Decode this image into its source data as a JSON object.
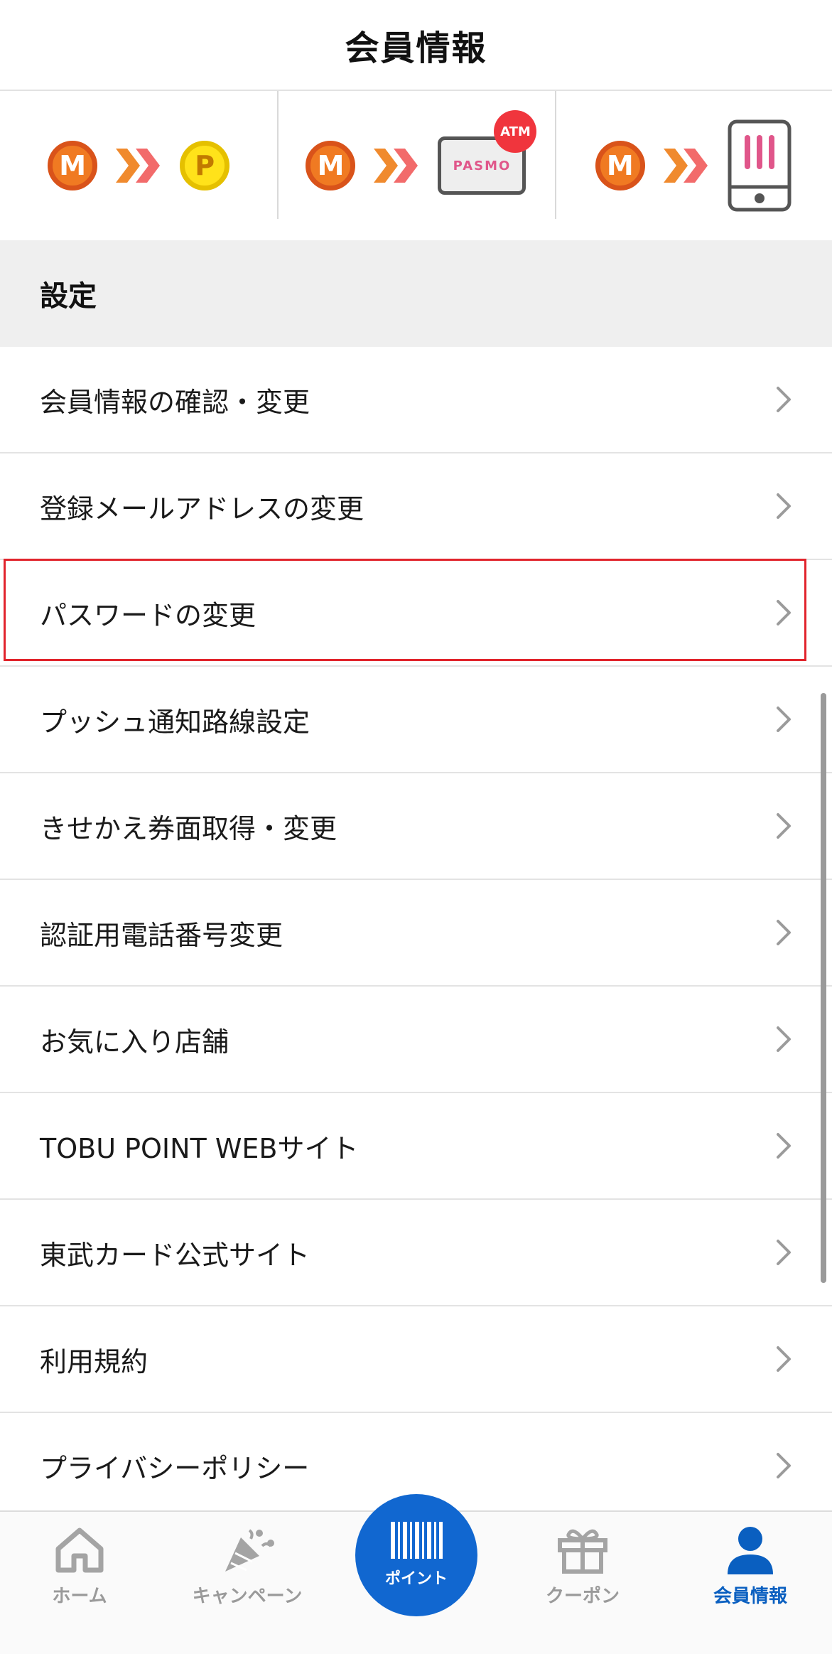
{
  "header": {
    "title": "会員情報"
  },
  "shortcuts": [
    {
      "name": "m-to-p",
      "from": "M",
      "to": "P"
    },
    {
      "name": "m-to-pasmo",
      "from": "M",
      "card_text": "PASMO",
      "badge": "ATM"
    },
    {
      "name": "m-to-mobile",
      "from": "M"
    }
  ],
  "section": {
    "title": "設定"
  },
  "menu": [
    {
      "label": "会員情報の確認・変更"
    },
    {
      "label": "登録メールアドレスの変更"
    },
    {
      "label": "パスワードの変更",
      "highlighted": true
    },
    {
      "label": "プッシュ通知路線設定"
    },
    {
      "label": "きせかえ券面取得・変更"
    },
    {
      "label": "認証用電話番号変更"
    },
    {
      "label": "お気に入り店舗"
    },
    {
      "label": "TOBU POINT WEBサイト"
    },
    {
      "label": "東武カード公式サイト"
    },
    {
      "label": "利用規約"
    },
    {
      "label": "プライバシーポリシー"
    }
  ],
  "tabs": [
    {
      "label": "ホーム",
      "icon": "home-icon"
    },
    {
      "label": "キャンペーン",
      "icon": "party-popper-icon"
    },
    {
      "label": "ポイント",
      "icon": "barcode-icon"
    },
    {
      "label": "クーポン",
      "icon": "gift-icon"
    },
    {
      "label": "会員情報",
      "icon": "user-icon",
      "active": true
    }
  ],
  "colors": {
    "accent": "#1167d0",
    "active_tab": "#0a5fc0",
    "highlight": "#e1242c",
    "coin_m": "#f07a22",
    "coin_p": "#ffe21a"
  }
}
